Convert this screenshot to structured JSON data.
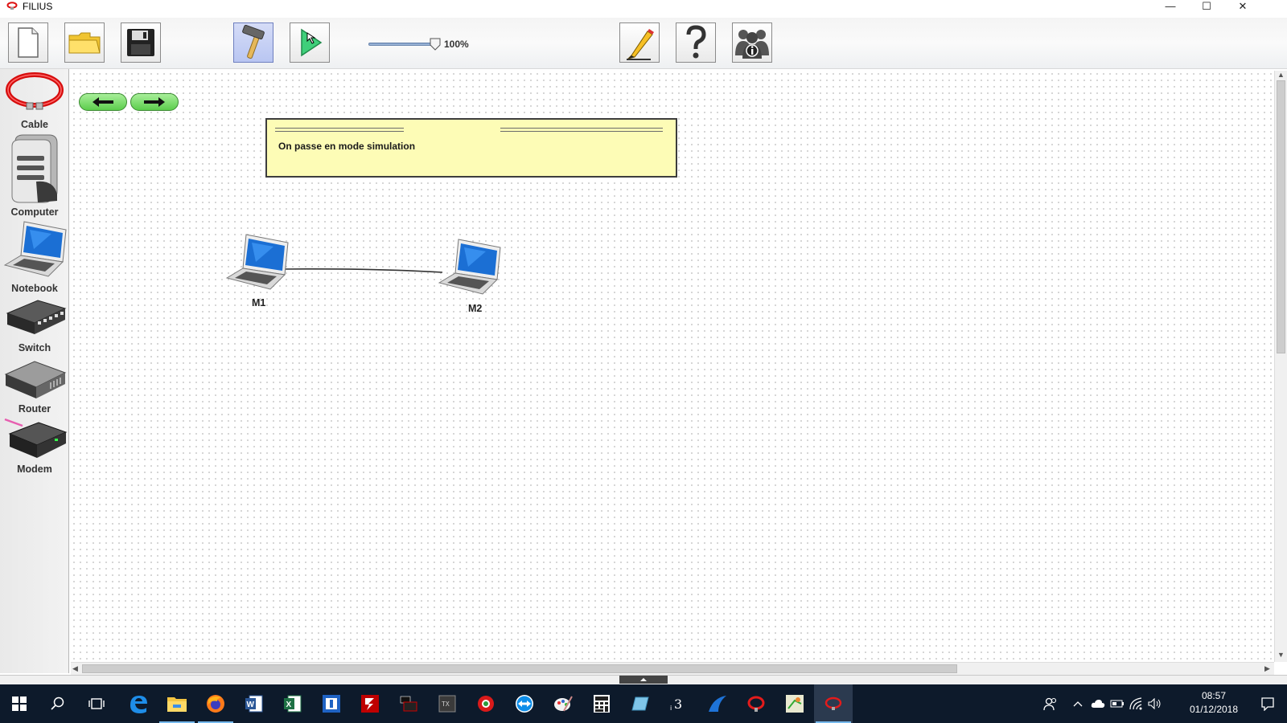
{
  "window": {
    "title": "FILIUS",
    "controls": [
      "—",
      "☐",
      "✕"
    ]
  },
  "toolbar": {
    "buttons": [
      "new-file",
      "open-folder",
      "save",
      "design-mode",
      "simulation-mode"
    ],
    "zoom_label": "100%",
    "zoom_fraction": 1.0,
    "right_buttons": [
      "edit-documentation",
      "help",
      "info"
    ]
  },
  "palette": {
    "items": [
      {
        "label": "Cable"
      },
      {
        "label": "Computer"
      },
      {
        "label": "Notebook"
      },
      {
        "label": "Switch"
      },
      {
        "label": "Router"
      },
      {
        "label": "Modem"
      }
    ]
  },
  "canvas": {
    "note_text": "On passe en mode simulation",
    "nodes": [
      {
        "label": "M1"
      },
      {
        "label": "M2"
      }
    ]
  },
  "taskbar": {
    "apps": [
      "start",
      "search",
      "task-view",
      "edge",
      "file-explorer",
      "firefox",
      "word",
      "excel",
      "app-blue",
      "filezilla",
      "app-dark",
      "app-calc",
      "app-red",
      "teamviewer",
      "paint",
      "calculator",
      "app-cyan",
      "app-3",
      "app-blue-wave",
      "filius",
      "app-misc",
      "filius-active"
    ],
    "clock_time": "08:57",
    "clock_date": "01/12/2018"
  }
}
